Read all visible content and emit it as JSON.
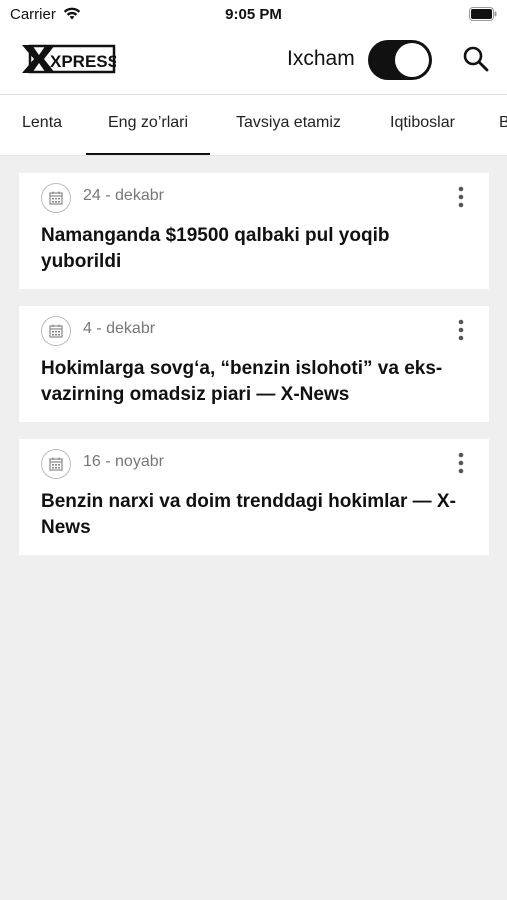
{
  "status": {
    "carrier": "Carrier",
    "time": "9:05 PM"
  },
  "header": {
    "logo_text": "XPRESS",
    "compact_label": "Ixcham"
  },
  "tabs": [
    {
      "label": "Lenta"
    },
    {
      "label": "Eng zo’rlari"
    },
    {
      "label": "Tavsiya etamiz"
    },
    {
      "label": "Iqtiboslar"
    },
    {
      "label": "B"
    }
  ],
  "articles": [
    {
      "date": "24 - dekabr",
      "title": "Namanganda $19500 qalbaki pul yoqib yuborildi"
    },
    {
      "date": "4 - dekabr",
      "title": "Hokimlarga sovg‘a, “benzin islohoti” va eks-vazirning omadsiz piari — X-News"
    },
    {
      "date": "16 - noyabr",
      "title": "Benzin narxi va doim trenddagi hokimlar — X-News"
    }
  ]
}
